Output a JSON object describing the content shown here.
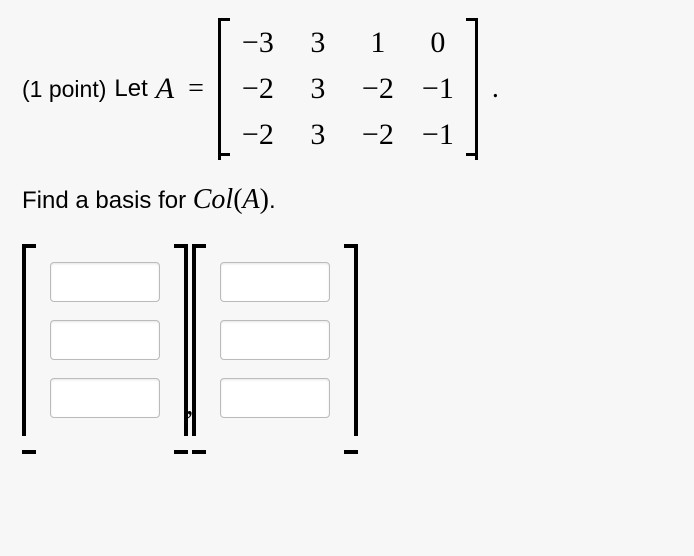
{
  "problem": {
    "points_label": "(1 point)",
    "let_text": "Let",
    "var_name": "A",
    "equals": "=",
    "period": "."
  },
  "matrix": {
    "r0c0": "−3",
    "r0c1": "3",
    "r0c2": "1",
    "r0c3": "0",
    "r1c0": "−2",
    "r1c1": "3",
    "r1c2": "−2",
    "r1c3": "−1",
    "r2c0": "−2",
    "r2c1": "3",
    "r2c2": "−2",
    "r2c3": "−1"
  },
  "question": {
    "prefix": "Find a basis for ",
    "col_label": "Col",
    "paren_open": "(",
    "var": "A",
    "paren_close": ")",
    "period": "."
  },
  "answer": {
    "v1": {
      "e0": "",
      "e1": "",
      "e2": ""
    },
    "v2": {
      "e0": "",
      "e1": "",
      "e2": ""
    },
    "comma": ","
  },
  "chart_data": {
    "type": "table",
    "title": "Matrix A (3×4)",
    "rows": [
      [
        -3,
        3,
        1,
        0
      ],
      [
        -2,
        3,
        -2,
        -1
      ],
      [
        -2,
        3,
        -2,
        -1
      ]
    ]
  }
}
